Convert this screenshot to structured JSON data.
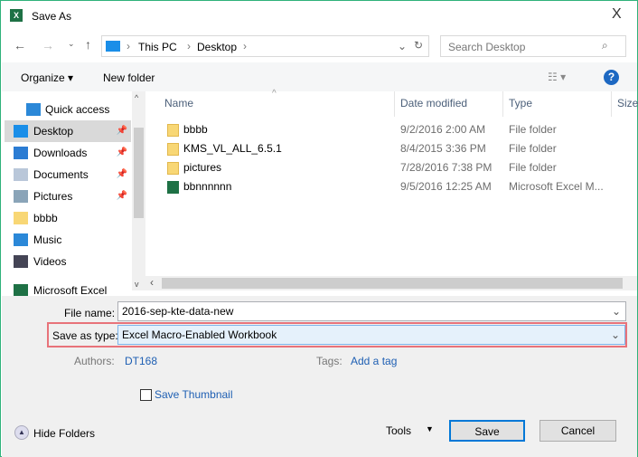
{
  "window": {
    "title": "Save As",
    "close": "X"
  },
  "address": {
    "path": [
      "This PC",
      "Desktop"
    ]
  },
  "search": {
    "placeholder": "Search Desktop"
  },
  "toolbar": {
    "organize": "Organize ▾",
    "new_folder": "New folder",
    "help": "?"
  },
  "sidebar": {
    "items": [
      {
        "label": "Quick access",
        "icon": "star-icon"
      },
      {
        "label": "Desktop",
        "icon": "desktop-icon",
        "pinned": true,
        "selected": true
      },
      {
        "label": "Downloads",
        "icon": "download-icon",
        "pinned": true
      },
      {
        "label": "Documents",
        "icon": "documents-icon",
        "pinned": true
      },
      {
        "label": "Pictures",
        "icon": "pictures-icon",
        "pinned": true
      },
      {
        "label": "bbbb",
        "icon": "folder-icon"
      },
      {
        "label": "Music",
        "icon": "music-icon"
      },
      {
        "label": "Videos",
        "icon": "videos-icon"
      },
      {
        "label": "Microsoft Excel",
        "icon": "excel-icon"
      }
    ]
  },
  "columns": [
    "Name",
    "Date modified",
    "Type",
    "Size"
  ],
  "files": [
    {
      "name": "bbbb",
      "date": "9/2/2016 2:00 AM",
      "type": "File folder",
      "icon": "folder-icon"
    },
    {
      "name": "KMS_VL_ALL_6.5.1",
      "date": "8/4/2015 3:36 PM",
      "type": "File folder",
      "icon": "folder-icon"
    },
    {
      "name": "pictures",
      "date": "7/28/2016 7:38 PM",
      "type": "File folder",
      "icon": "folder-icon"
    },
    {
      "name": "bbnnnnnn",
      "date": "9/5/2016 12:25 AM",
      "type": "Microsoft Excel M...",
      "icon": "excel-file-icon"
    }
  ],
  "form": {
    "file_name_label": "File name:",
    "file_name": "2016-sep-kte-data-new",
    "type_label": "Save as type:",
    "type": "Excel Macro-Enabled Workbook",
    "authors_label": "Authors:",
    "authors": "DT168",
    "tags_label": "Tags:",
    "tags": "Add a tag",
    "thumbnail": "Save Thumbnail",
    "highlight_color": "#e8737a"
  },
  "footer": {
    "hide_folders": "Hide Folders",
    "tools": "Tools",
    "save": "Save",
    "cancel": "Cancel"
  }
}
